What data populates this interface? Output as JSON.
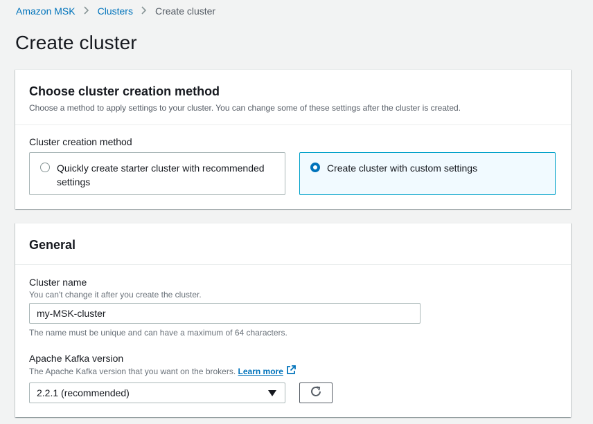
{
  "breadcrumb": {
    "items": [
      "Amazon MSK",
      "Clusters"
    ],
    "current": "Create cluster"
  },
  "page_title": "Create cluster",
  "creation_method_panel": {
    "title": "Choose cluster creation method",
    "description": "Choose a method to apply settings to your cluster. You can change some of these settings after the cluster is created.",
    "field_label": "Cluster creation method",
    "options": [
      {
        "label": "Quickly create starter cluster with recommended settings",
        "selected": false
      },
      {
        "label": "Create cluster with custom settings",
        "selected": true
      }
    ]
  },
  "general_panel": {
    "title": "General",
    "cluster_name": {
      "label": "Cluster name",
      "hint": "You can't change it after you create the cluster.",
      "value": "my-MSK-cluster",
      "constraint": "The name must be unique and can have a maximum of 64 characters."
    },
    "kafka_version": {
      "label": "Apache Kafka version",
      "hint": "The Apache Kafka version that you want on the brokers.",
      "learn_more": "Learn more",
      "selected": "2.2.1 (recommended)"
    }
  },
  "icons": {
    "breadcrumb_separator": "chevron-right-icon",
    "external_link": "external-link-icon",
    "refresh": "refresh-icon",
    "dropdown": "caret-down-icon"
  },
  "colors": {
    "link": "#0073bb",
    "selected_border": "#00a1c9",
    "selected_bg": "#f1faff",
    "page_bg": "#f2f3f3"
  }
}
